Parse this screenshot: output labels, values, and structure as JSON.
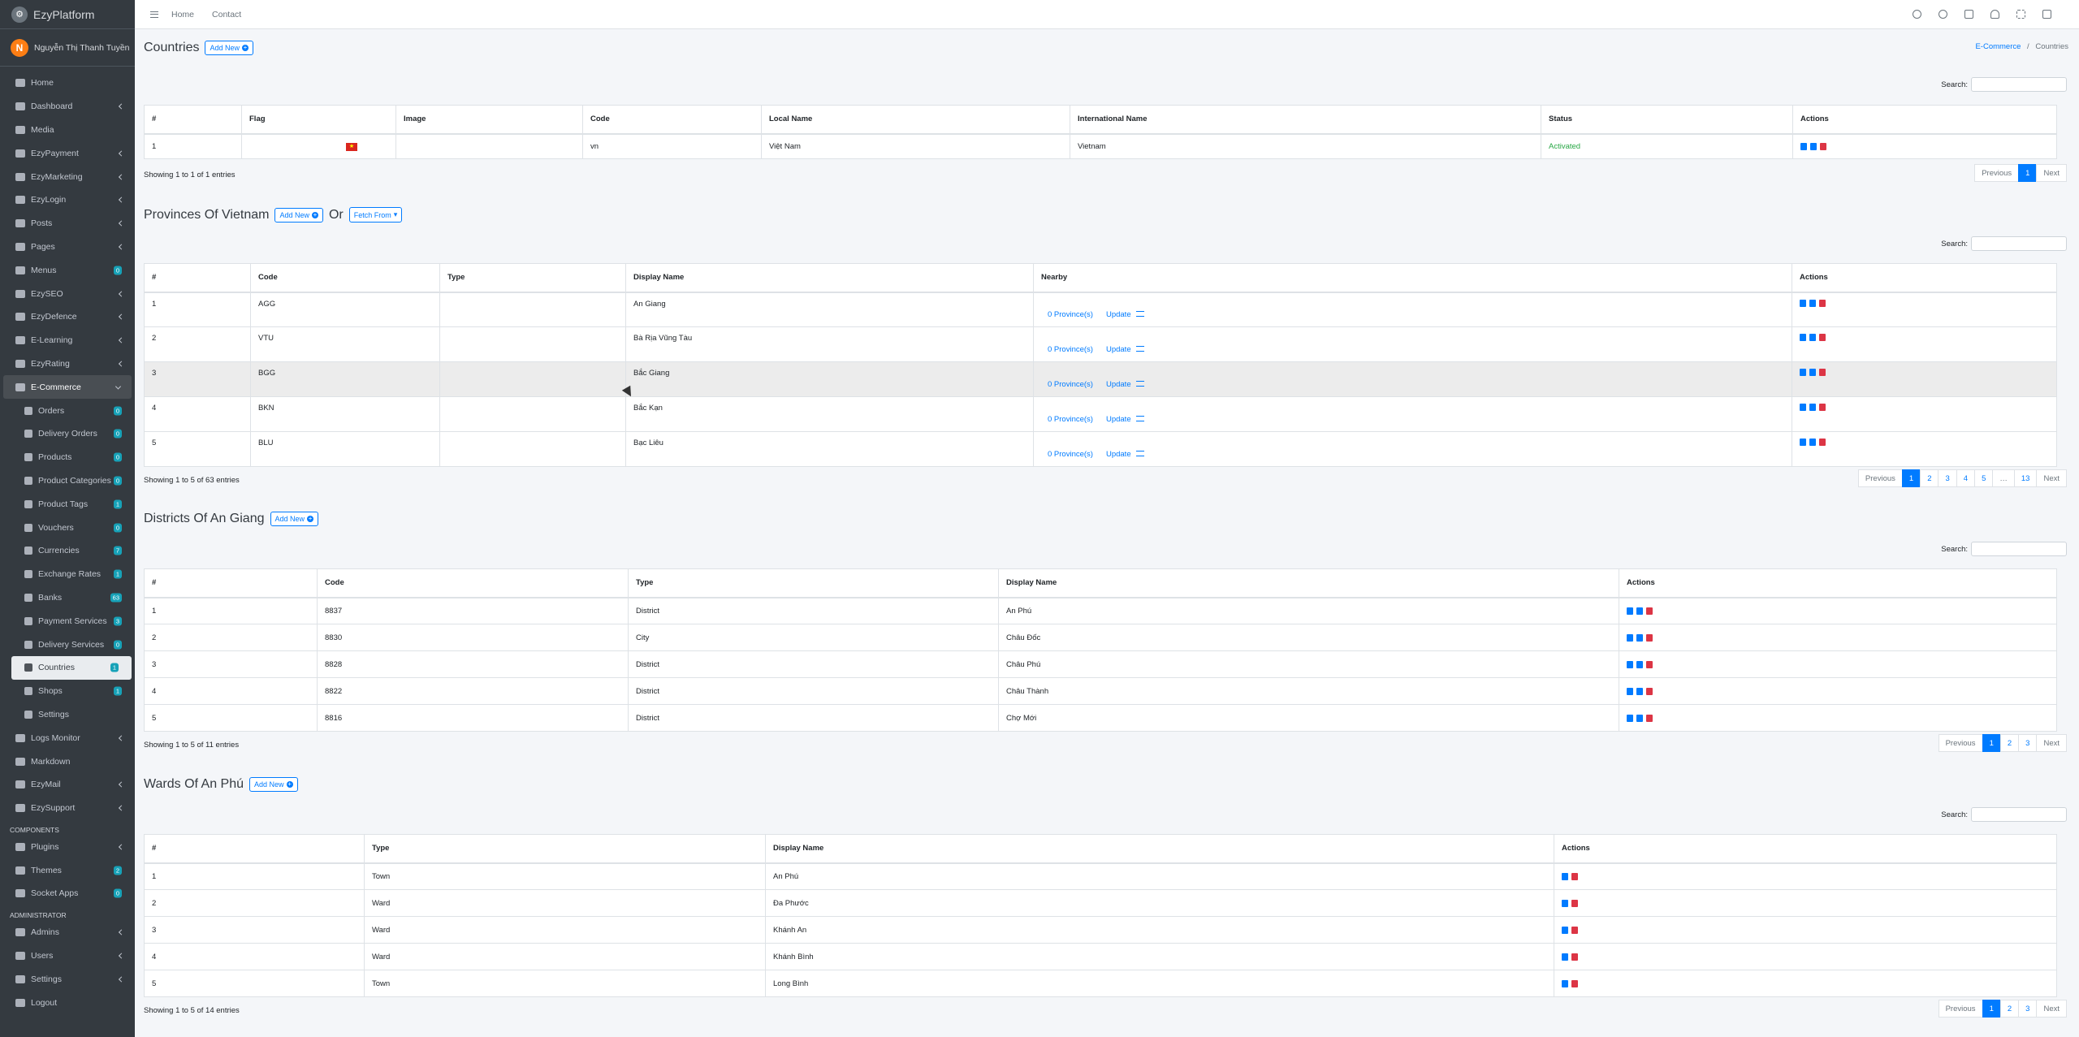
{
  "brand": {
    "name": "EzyPlatform",
    "logo_icon": "ezyplatform-logo-icon"
  },
  "user": {
    "initial": "N",
    "name": "Nguyễn Thị Thanh Tuyền"
  },
  "topbar": {
    "links": [
      "Home",
      "Contact"
    ]
  },
  "sidebar": {
    "items": [
      {
        "label": "Home",
        "icon": "home-icon"
      },
      {
        "label": "Dashboard",
        "icon": "dashboard-icon",
        "arrow": true
      },
      {
        "label": "Media",
        "icon": "media-icon"
      },
      {
        "label": "EzyPayment",
        "icon": "payment-icon",
        "arrow": true
      },
      {
        "label": "EzyMarketing",
        "icon": "marketing-icon",
        "arrow": true
      },
      {
        "label": "EzyLogin",
        "icon": "login-icon",
        "arrow": true
      },
      {
        "label": "Posts",
        "icon": "posts-icon",
        "arrow": true
      },
      {
        "label": "Pages",
        "icon": "pages-icon",
        "arrow": true
      },
      {
        "label": "Menus",
        "icon": "menus-icon",
        "badge": "0"
      },
      {
        "label": "EzySEO",
        "icon": "seo-icon",
        "arrow": true
      },
      {
        "label": "EzyDefence",
        "icon": "shield-icon",
        "arrow": true
      },
      {
        "label": "E-Learning",
        "icon": "elearning-icon",
        "arrow": true
      },
      {
        "label": "EzyRating",
        "icon": "star-icon",
        "arrow": true
      },
      {
        "label": "E-Commerce",
        "icon": "shop-icon",
        "open": true
      },
      {
        "label": "Orders",
        "icon": "orders-icon",
        "sub": true,
        "badge": "0"
      },
      {
        "label": "Delivery Orders",
        "icon": "delivery-orders-icon",
        "sub": true,
        "badge": "0"
      },
      {
        "label": "Products",
        "icon": "products-icon",
        "sub": true,
        "badge": "0"
      },
      {
        "label": "Product Categories",
        "icon": "categories-icon",
        "sub": true,
        "badge": "0"
      },
      {
        "label": "Product Tags",
        "icon": "tags-icon",
        "sub": true,
        "badge": "1"
      },
      {
        "label": "Vouchers",
        "icon": "voucher-icon",
        "sub": true,
        "badge": "0"
      },
      {
        "label": "Currencies",
        "icon": "currency-icon",
        "sub": true,
        "badge": "7"
      },
      {
        "label": "Exchange Rates",
        "icon": "exchange-icon",
        "sub": true,
        "badge": "1"
      },
      {
        "label": "Banks",
        "icon": "bank-icon",
        "sub": true,
        "badge": "63"
      },
      {
        "label": "Payment Services",
        "icon": "payment-services-icon",
        "sub": true,
        "badge": "3"
      },
      {
        "label": "Delivery Services",
        "icon": "truck-icon",
        "sub": true,
        "badge": "0"
      },
      {
        "label": "Countries",
        "icon": "globe-icon",
        "sub": true,
        "badge": "1",
        "active": true
      },
      {
        "label": "Shops",
        "icon": "shops-icon",
        "sub": true,
        "badge": "1"
      },
      {
        "label": "Settings",
        "icon": "settings-icon",
        "sub": true
      },
      {
        "label": "Logs Monitor",
        "icon": "logs-icon",
        "arrow": true
      },
      {
        "label": "Markdown",
        "icon": "markdown-icon"
      },
      {
        "label": "EzyMail",
        "icon": "mail-icon",
        "arrow": true
      },
      {
        "label": "EzySupport",
        "icon": "support-icon",
        "arrow": true
      },
      {
        "header": "COMPONENTS"
      },
      {
        "label": "Plugins",
        "icon": "plugins-icon",
        "arrow": true
      },
      {
        "label": "Themes",
        "icon": "themes-icon",
        "badge": "2"
      },
      {
        "label": "Socket Apps",
        "icon": "socket-icon",
        "badge": "0"
      },
      {
        "header": "ADMINISTRATOR"
      },
      {
        "label": "Admins",
        "icon": "admins-icon",
        "arrow": true
      },
      {
        "label": "Users",
        "icon": "users-icon",
        "arrow": true
      },
      {
        "label": "Settings",
        "icon": "gear-icon",
        "arrow": true
      },
      {
        "label": "Logout",
        "icon": "logout-icon"
      }
    ]
  },
  "breadcrumb": {
    "parent": "E-Commerce",
    "sep": "/",
    "current": "Countries"
  },
  "search_label": "Search:",
  "countries": {
    "title": "Countries",
    "add": "Add New",
    "columns": [
      "#",
      "Flag",
      "Image",
      "Code",
      "Local Name",
      "International Name",
      "Status",
      "Actions"
    ],
    "rows": [
      [
        "1",
        "★",
        "",
        "vn",
        "Việt Nam",
        "Vietnam",
        "Activated"
      ]
    ],
    "info": "Showing 1 to 1 of 1 entries",
    "pages": [
      "Previous",
      "1",
      "Next"
    ]
  },
  "provinces": {
    "title": "Provinces Of Vietnam",
    "add": "Add New",
    "or": "Or",
    "fetch": "Fetch From",
    "columns": [
      "#",
      "Code",
      "Type",
      "Display Name",
      "Nearby",
      "Actions"
    ],
    "nearby_text": "0 Province(s)",
    "update": "Update",
    "rows": [
      [
        "1",
        "AGG",
        "",
        "An Giang"
      ],
      [
        "2",
        "VTU",
        "",
        "Bà Rịa Vũng Tàu"
      ],
      [
        "3",
        "BGG",
        "",
        "Bắc Giang"
      ],
      [
        "4",
        "BKN",
        "",
        "Bắc Kạn"
      ],
      [
        "5",
        "BLU",
        "",
        "Bạc Liêu"
      ]
    ],
    "info": "Showing 1 to 5 of 63 entries",
    "pages": [
      "Previous",
      "1",
      "2",
      "3",
      "4",
      "5",
      "…",
      "13",
      "Next"
    ]
  },
  "districts": {
    "title": "Districts Of An Giang",
    "add": "Add New",
    "columns": [
      "#",
      "Code",
      "Type",
      "Display Name",
      "Actions"
    ],
    "rows": [
      [
        "1",
        "8837",
        "District",
        "An Phú"
      ],
      [
        "2",
        "8830",
        "City",
        "Châu Đốc"
      ],
      [
        "3",
        "8828",
        "District",
        "Châu Phú"
      ],
      [
        "4",
        "8822",
        "District",
        "Châu Thành"
      ],
      [
        "5",
        "8816",
        "District",
        "Chợ Mới"
      ]
    ],
    "info": "Showing 1 to 5 of 11 entries",
    "pages": [
      "Previous",
      "1",
      "2",
      "3",
      "Next"
    ]
  },
  "wards": {
    "title": "Wards Of An Phú",
    "add": "Add New",
    "columns": [
      "#",
      "Type",
      "Display Name",
      "Actions"
    ],
    "rows": [
      [
        "1",
        "Town",
        "An Phú"
      ],
      [
        "2",
        "Ward",
        "Đa Phước"
      ],
      [
        "3",
        "Ward",
        "Khánh An"
      ],
      [
        "4",
        "Ward",
        "Khánh Bình"
      ],
      [
        "5",
        "Town",
        "Long Bình"
      ]
    ],
    "info": "Showing 1 to 5 of 14 entries",
    "pages": [
      "Previous",
      "1",
      "2",
      "3",
      "Next"
    ]
  }
}
